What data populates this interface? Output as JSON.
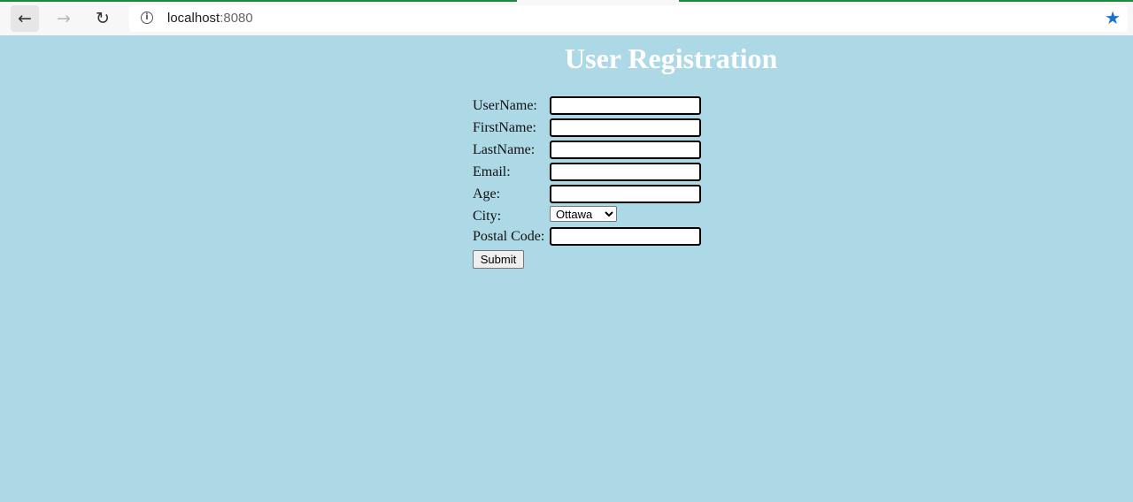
{
  "browser": {
    "back_icon": "arrow-left-icon",
    "forward_icon": "arrow-right-icon",
    "reload_icon": "reload-icon",
    "info_icon": "info-icon",
    "bookmark_icon": "star-icon",
    "url_host": "localhost",
    "url_port": ":8080",
    "accent_color": "#1a73c8",
    "loading_color": "#1e8a3c"
  },
  "page": {
    "background_color": "#add8e6",
    "title": "User Registration"
  },
  "form": {
    "fields": [
      {
        "label": "UserName:",
        "value": ""
      },
      {
        "label": "FirstName:",
        "value": ""
      },
      {
        "label": "LastName:",
        "value": ""
      },
      {
        "label": "Email:",
        "value": ""
      },
      {
        "label": "Age:",
        "value": ""
      }
    ],
    "city": {
      "label": "City:",
      "selected": "Ottawa"
    },
    "postal_code": {
      "label": "Postal Code:",
      "value": ""
    },
    "submit_label": "Submit"
  }
}
